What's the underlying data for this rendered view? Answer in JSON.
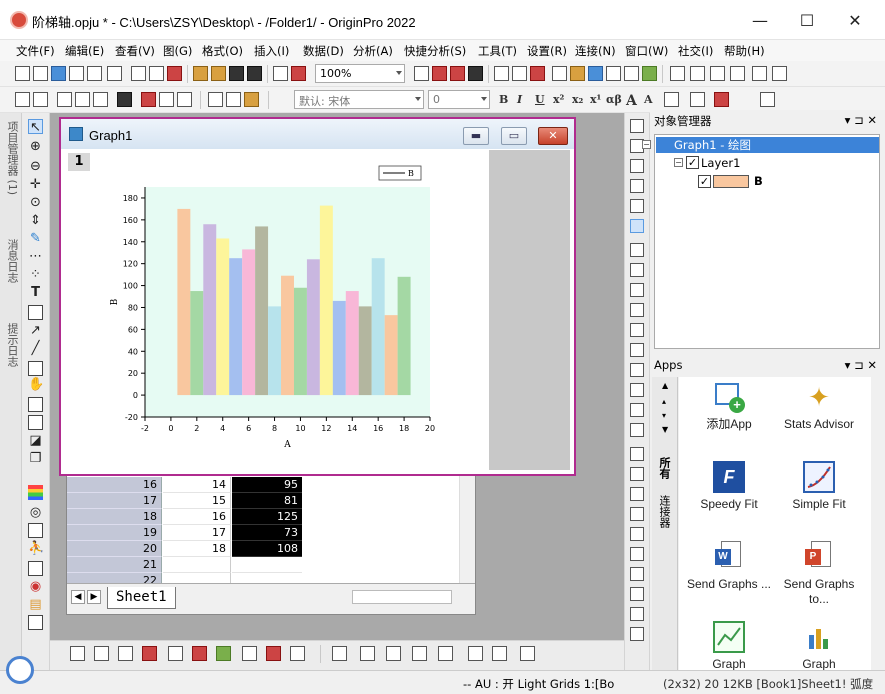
{
  "window": {
    "title": "阶梯轴.opju * - C:\\Users\\ZSY\\Desktop\\ - /Folder1/ - OriginPro 2022",
    "minimize": "—",
    "maximize": "☐",
    "close": "✕"
  },
  "menu": [
    "文件(F)",
    "编辑(E)",
    "查看(V)",
    "图(G)",
    "格式(O)",
    "插入(I)",
    "数据(D)",
    "分析(A)",
    "快捷分析(S)",
    "工具(T)",
    "设置(R)",
    "连接(N)",
    "窗口(W)",
    "社交(I)",
    "帮助(H)"
  ],
  "toolbar": {
    "zoom": "100%",
    "font": "默认: 宋体",
    "font_size": "0",
    "fmt": [
      "B",
      "I",
      "U",
      "x²",
      "x₂",
      "x¹",
      "αβ",
      "A",
      "A"
    ]
  },
  "left_tabs": [
    "项目管理器 (1)",
    "消息日志",
    "提示日志"
  ],
  "graph": {
    "window_title": "Graph1",
    "layer_number": "1",
    "legend_label": "B",
    "bg_color": "#e6fbf3",
    "bar_colors": [
      "#f9c79f",
      "#a4d8a4",
      "#c9b7e0",
      "#fdf59a",
      "#a4bff0",
      "#f8b7d7",
      "#b3b69f",
      "#b7e3ec",
      "#f9c79f",
      "#a4d8a4",
      "#c9b7e0",
      "#fdf59a",
      "#a4bff0",
      "#f8b7d7",
      "#b3b69f",
      "#b7e3ec",
      "#f9c79f",
      "#a4d8a4"
    ]
  },
  "chart_data": {
    "type": "bar",
    "x": [
      1,
      2,
      3,
      4,
      5,
      6,
      7,
      8,
      9,
      10,
      11,
      12,
      13,
      14,
      15,
      16,
      17,
      18
    ],
    "values": [
      170,
      95,
      156,
      143,
      125,
      133,
      154,
      81,
      109,
      98,
      124,
      173,
      86,
      95,
      81,
      125,
      73,
      108
    ],
    "xlabel": "A",
    "ylabel": "B",
    "xlim": [
      -2,
      20
    ],
    "ylim": [
      -20,
      190
    ],
    "xticks": [
      -2,
      0,
      2,
      4,
      6,
      8,
      10,
      12,
      14,
      16,
      18,
      20
    ],
    "yticks": [
      -20,
      0,
      20,
      40,
      60,
      80,
      100,
      120,
      140,
      160,
      180
    ],
    "legend": [
      "B"
    ],
    "legend_position": "top-right"
  },
  "worksheet": {
    "rows": [
      {
        "n": "16",
        "a": "14",
        "b": "95"
      },
      {
        "n": "17",
        "a": "15",
        "b": "81"
      },
      {
        "n": "18",
        "a": "16",
        "b": "125"
      },
      {
        "n": "19",
        "a": "17",
        "b": "73"
      },
      {
        "n": "20",
        "a": "18",
        "b": "108"
      },
      {
        "n": "21",
        "a": "",
        "b": ""
      },
      {
        "n": "22",
        "a": "",
        "b": ""
      }
    ],
    "sheet_tab": "Sheet1"
  },
  "object_manager": {
    "title": "对象管理器",
    "graph_node": "Graph1 - 绘图",
    "layer_node": "Layer1",
    "plot_node": "B",
    "plot_color": "#f9c79f"
  },
  "apps": {
    "title": "Apps",
    "side_tabs": [
      "所有",
      "连接器"
    ],
    "items": [
      {
        "label": "添加App"
      },
      {
        "label": "Stats Advisor"
      },
      {
        "label": "Speedy Fit"
      },
      {
        "label": "Simple Fit"
      },
      {
        "label": "Send Graphs ..."
      },
      {
        "label": "Send Graphs to..."
      },
      {
        "label": "Graph"
      },
      {
        "label": "Graph"
      }
    ]
  },
  "status": {
    "left": "--   AU : 开  Light Grids  1:[Bo",
    "right": "(2x32) 20  12KB  [Book1]Sheet1!  弧度"
  }
}
